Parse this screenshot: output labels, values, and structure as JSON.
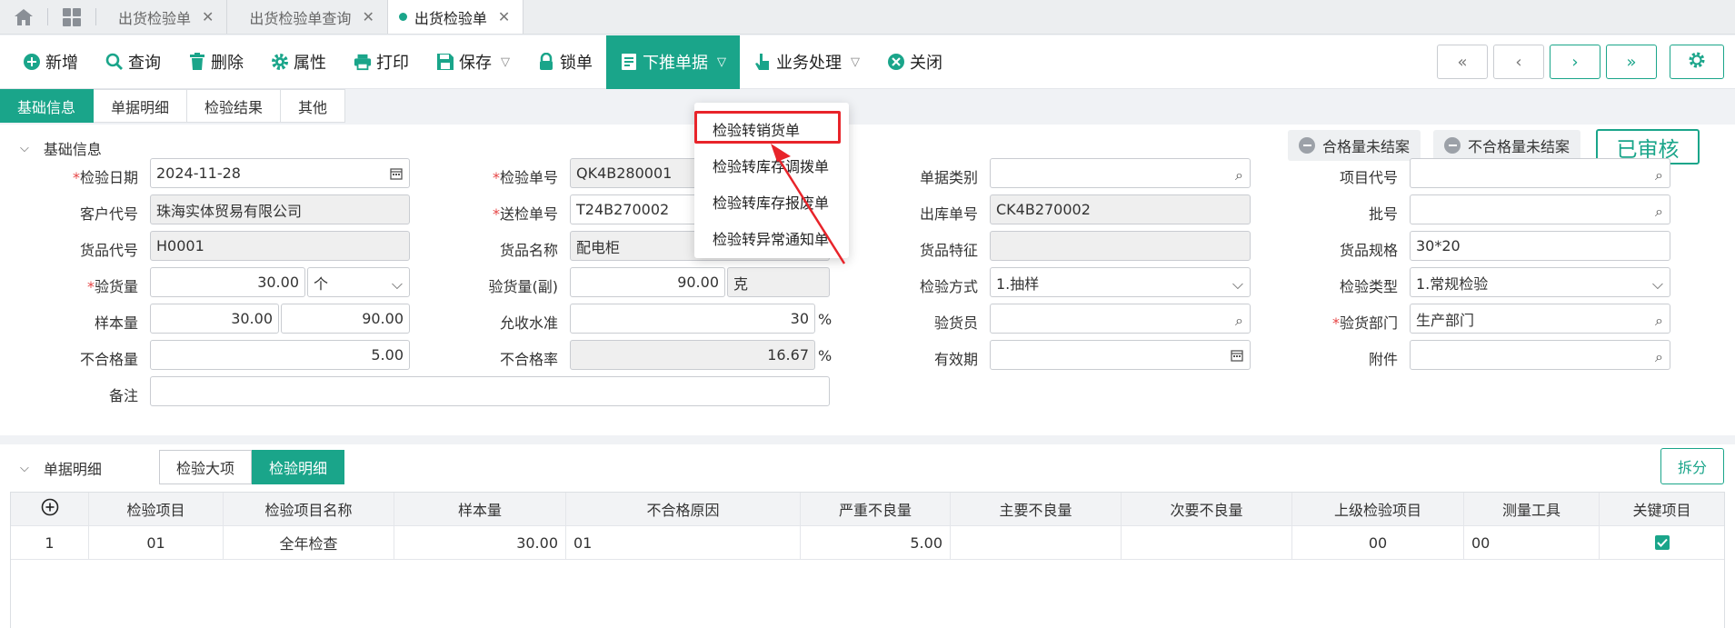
{
  "tabs": [
    {
      "label": "出货检验单"
    },
    {
      "label": "出货检验单查询"
    },
    {
      "label": "出货检验单"
    }
  ],
  "toolbar": {
    "add": "新增",
    "query": "查询",
    "delete": "删除",
    "properties": "属性",
    "print": "打印",
    "save": "保存",
    "lock": "锁单",
    "push_down": "下推单据",
    "business": "业务处理",
    "close": "关闭"
  },
  "subtabs": [
    "基础信息",
    "单据明细",
    "检验结果",
    "其他"
  ],
  "basic": {
    "section_title": "基础信息",
    "chip_qualified": "合格量未结案",
    "chip_unqualified": "不合格量未结案",
    "status": "已审核",
    "fields": {
      "inspect_date": {
        "label": "检验日期",
        "value": "2024-11-28"
      },
      "inspect_no": {
        "label": "检验单号",
        "value": "QK4B280001"
      },
      "doc_type": {
        "label": "单据类别",
        "value": ""
      },
      "project_code": {
        "label": "项目代号",
        "value": ""
      },
      "customer_code": {
        "label": "客户代号",
        "value": "珠海实体贸易有限公司"
      },
      "submit_no": {
        "label": "送检单号",
        "value": "T24B270002"
      },
      "outbound_no": {
        "label": "出库单号",
        "value": "CK4B270002"
      },
      "batch_no": {
        "label": "批号",
        "value": ""
      },
      "goods_code": {
        "label": "货品代号",
        "value": "H0001"
      },
      "goods_name": {
        "label": "货品名称",
        "value": "配电柜"
      },
      "goods_feature": {
        "label": "货品特征",
        "value": ""
      },
      "goods_spec": {
        "label": "货品规格",
        "value": "30*20"
      },
      "inspect_qty": {
        "label": "验货量",
        "value": "30.00",
        "unit": "个"
      },
      "inspect_qty_sub": {
        "label": "验货量(副)",
        "value": "90.00",
        "unit": "克"
      },
      "inspect_method": {
        "label": "检验方式",
        "value": "1.抽样"
      },
      "inspect_type": {
        "label": "检验类型",
        "value": "1.常规检验"
      },
      "sample_qty": {
        "label": "样本量",
        "value": "30.00",
        "value2": "90.00"
      },
      "accept_level": {
        "label": "允收水准",
        "value": "30",
        "unit": "%"
      },
      "inspector": {
        "label": "验货员",
        "value": ""
      },
      "inspect_dept": {
        "label": "验货部门",
        "value": "生产部门"
      },
      "defect_qty": {
        "label": "不合格量",
        "value": "5.00"
      },
      "defect_rate": {
        "label": "不合格率",
        "value": "16.67",
        "unit": "%"
      },
      "validity": {
        "label": "有效期",
        "value": ""
      },
      "attachment": {
        "label": "附件",
        "value": ""
      },
      "remark": {
        "label": "备注",
        "value": ""
      }
    }
  },
  "detail": {
    "section_title": "单据明细",
    "tabs": [
      "检验大项",
      "检验明细"
    ],
    "split": "拆分",
    "columns": [
      "检验项目",
      "检验项目名称",
      "样本量",
      "不合格原因",
      "严重不良量",
      "主要不良量",
      "次要不良量",
      "上级检验项目",
      "测量工具",
      "关键项目"
    ],
    "rows": [
      {
        "no": "1",
        "item": "01",
        "name": "全年检查",
        "sample": "30.00",
        "reason": "01",
        "critical": "5.00",
        "major": "",
        "minor": "",
        "parent": "00",
        "tool": "00",
        "key": true
      }
    ]
  },
  "dropdown": {
    "items": [
      "检验转销货单",
      "检验转库存调拨单",
      "检验转库存报废单",
      "检验转异常通知单"
    ]
  },
  "colors": {
    "accent": "#1aa58a",
    "highlight": "#e8242a"
  }
}
